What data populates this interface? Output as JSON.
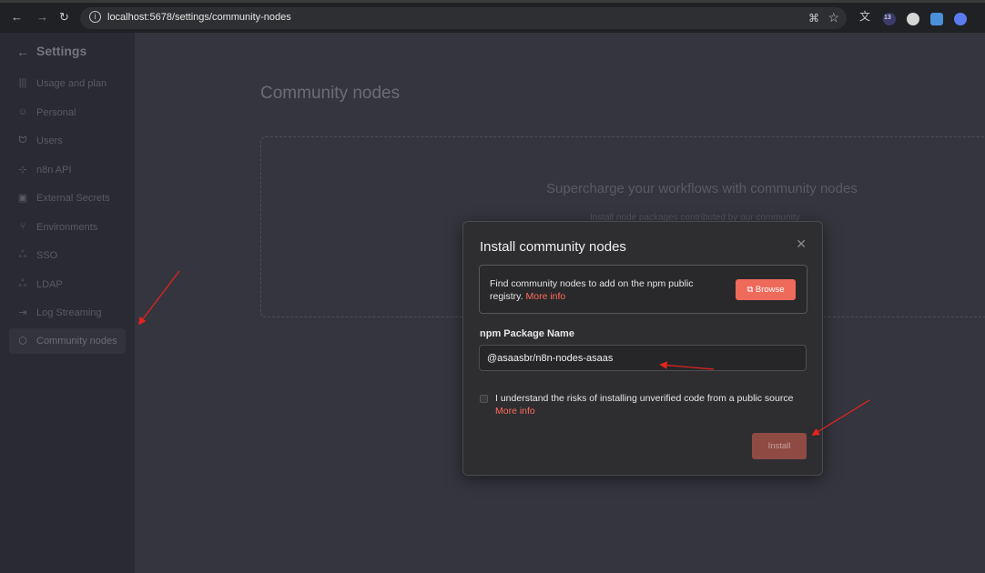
{
  "browser": {
    "url": "localhost:5678/settings/community-nodes",
    "ext_badge": "13"
  },
  "sidebar": {
    "title": "Settings",
    "items": [
      {
        "label": "Usage and plan",
        "icon": "chart-bar-icon",
        "glyph": "|||"
      },
      {
        "label": "Personal",
        "icon": "user-circle-icon",
        "glyph": "☺"
      },
      {
        "label": "Users",
        "icon": "user-icon",
        "glyph": "ᗢ"
      },
      {
        "label": "n8n API",
        "icon": "plug-icon",
        "glyph": "⊹"
      },
      {
        "label": "External Secrets",
        "icon": "vault-icon",
        "glyph": "▣"
      },
      {
        "label": "Environments",
        "icon": "branch-icon",
        "glyph": "⑂"
      },
      {
        "label": "SSO",
        "icon": "users-icon",
        "glyph": "ஃ"
      },
      {
        "label": "LDAP",
        "icon": "network-icon",
        "glyph": "ஃ"
      },
      {
        "label": "Log Streaming",
        "icon": "sign-in-icon",
        "glyph": "⇥"
      },
      {
        "label": "Community nodes",
        "icon": "cube-icon",
        "glyph": "⬡"
      }
    ]
  },
  "main": {
    "title": "Community nodes",
    "empty_title": "Supercharge your workflows with community nodes",
    "empty_sub": "Install node packages contributed by our community"
  },
  "modal": {
    "title": "Install community nodes",
    "info_text": "Find community nodes to add on the npm public registry.",
    "info_link": "More info",
    "browse_label": "Browse",
    "field_label": "npm Package Name",
    "input_value": "@asaasbr/n8n-nodes-asaas",
    "checkbox_label": "I understand the risks of installing unverified code from a public source",
    "checkbox_link": "More info",
    "install_label": "Install"
  },
  "colors": {
    "accent": "#ff6d5a",
    "annotation": "#e8231c"
  }
}
